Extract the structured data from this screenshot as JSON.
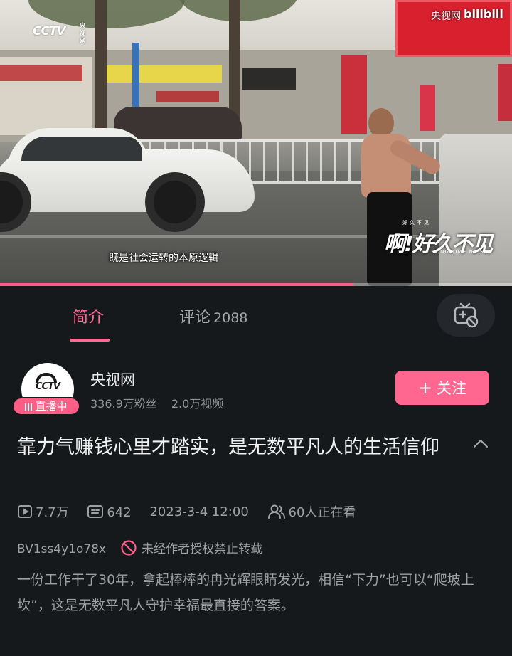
{
  "video": {
    "watermark_cctv": "CCTV",
    "watermark_cctv_small": "央视网",
    "watermark_site": "央视网",
    "watermark_bili": "bilibili",
    "overlay_title": "啊!好久不见",
    "overlay_top": "好久不见",
    "overlay_sub": "LONG TIME NO SEE",
    "subtitle": "既是社会运转的本原逻辑",
    "progress": 0.69
  },
  "tabs": [
    {
      "label": "简介",
      "active": true
    },
    {
      "label": "评论",
      "count": "2088",
      "active": false
    }
  ],
  "uploader": {
    "name": "央视网",
    "live_badge": "直播中",
    "followers": "336.9万粉丝",
    "videos": "2.0万视频",
    "avatar_logo": "CCTV",
    "follow_label": "关注",
    "follow_plus": "+"
  },
  "video_info": {
    "title": "靠力气赚钱心里才踏实，是无数平凡人的生活信仰",
    "plays": "7.7万",
    "danmaku": "642",
    "date": "2023-3-4 12:00",
    "watching": "60人正在看",
    "bvid": "BV1ss4y1o78x",
    "no_repost": "未经作者授权禁止转载",
    "description": "一份工作干了30年，拿起棒棒的冉光辉眼睛发光，相信“下力”也可以“爬坡上坎”，这是无数平凡人守护幸福最直接的答案。"
  },
  "colors": {
    "accent": "#ff6690",
    "background": "#16191c",
    "muted_text": "#9ea0a4"
  },
  "icons": [
    "play-count-icon",
    "danmaku-icon",
    "watching-icon",
    "no-repost-icon",
    "tv-icon",
    "chevron-up-icon",
    "live-bars-icon"
  ]
}
